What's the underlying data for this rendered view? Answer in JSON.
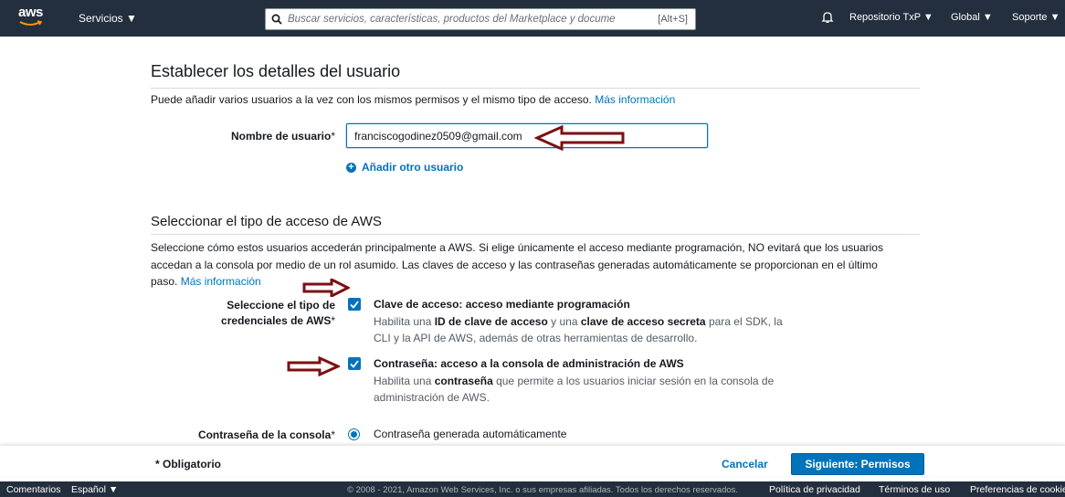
{
  "nav": {
    "logo_text": "aws",
    "services": "Servicios ▼",
    "search_placeholder": "Buscar servicios, características, productos del Marketplace y docume",
    "search_shortcut": "[Alt+S]",
    "account": "Repositorio TxP ▼",
    "region": "Global ▼",
    "support": "Soporte ▼",
    "icons": [
      "search-icon",
      "bell-icon"
    ]
  },
  "details": {
    "title": "Establecer los detalles del usuario",
    "intro": "Puede añadir varios usuarios a la vez con los mismos permisos y el mismo tipo de acceso.",
    "more_info": "Más información",
    "username_label": "Nombre de usuario",
    "required_mark": "*",
    "username_value": "franciscogodinez0509@gmail.com",
    "add_user": "Añadir otro usuario"
  },
  "access": {
    "title": "Seleccionar el tipo de acceso de AWS",
    "desc_line1": "Seleccione cómo estos usuarios accederán principalmente a AWS. Si elige únicamente el acceso mediante programación, NO evitará que los usuarios",
    "desc_line2": "accedan a la consola por medio de un rol asumido. Las claves de acceso y las contraseñas generadas automáticamente se proporcionan en el último",
    "desc_line3": "paso.",
    "more_info": "Más información",
    "cred_label_line1": "Seleccione el tipo de",
    "cred_label_line2": "credenciales de AWS",
    "opt1_title": "Clave de acceso: acceso mediante programación",
    "opt1_a": "Habilita una ",
    "opt1_b": "ID de clave de acceso",
    "opt1_c": " y una ",
    "opt1_d": "clave de acceso secreta",
    "opt1_e": " para el SDK, la",
    "opt1_line2": "CLI y la API de AWS, además de otras herramientas de desarrollo.",
    "opt2_title": "Contraseña: acceso a la consola de administración de AWS",
    "opt2_a": "Habilita una ",
    "opt2_b": "contraseña",
    "opt2_c": " que permite a los usuarios iniciar sesión en la consola de",
    "opt2_line2": "administración de AWS.",
    "console_pw_label": "Contraseña de la consola",
    "console_pw_option": "Contraseña generada automáticamente"
  },
  "actions": {
    "required_note": "* Obligatorio",
    "cancel": "Cancelar",
    "next": "Siguiente: Permisos"
  },
  "footer": {
    "feedback": "Comentarios",
    "language": "Español ▼",
    "copyright": "© 2008 - 2021, Amazon Web Services, Inc. o sus empresas afiliadas. Todos los derechos reservados.",
    "privacy": "Política de privacidad",
    "terms": "Términos de uso",
    "cookies": "Preferencias de cookies"
  },
  "colors": {
    "nav_bg": "#232f3e",
    "link": "#0073bb",
    "primary_button": "#0073bb",
    "annotation_arrow": "#7b1113"
  }
}
